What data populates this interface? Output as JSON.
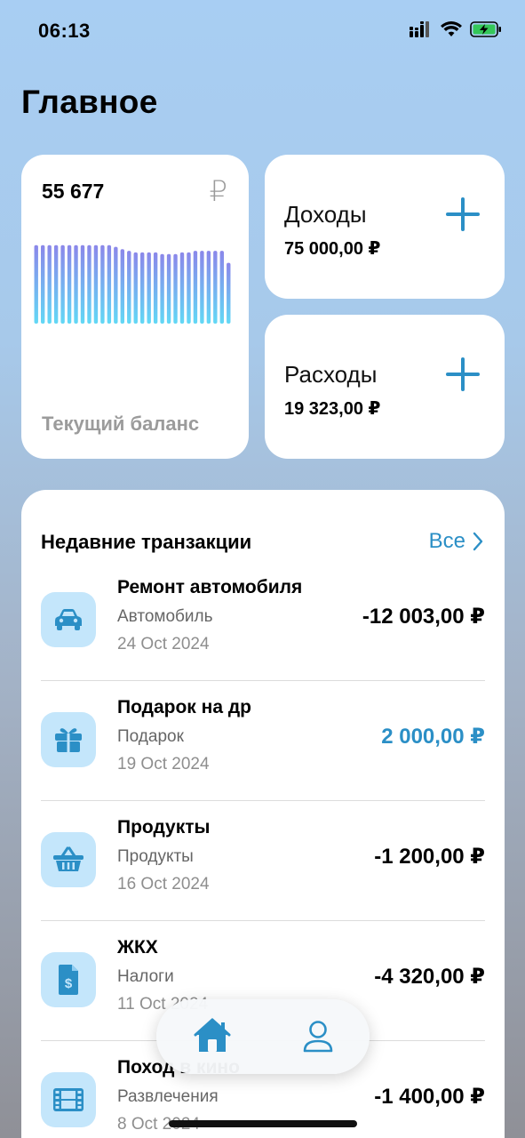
{
  "status_bar": {
    "time": "06:13",
    "signal_icon": "cellular-signal-icon",
    "wifi_icon": "wifi-icon",
    "battery_icon": "battery-charging-icon",
    "battery_color": "#34c759"
  },
  "page": {
    "title": "Главное"
  },
  "balance": {
    "amount": "55 677",
    "currency_symbol": "₽",
    "label": "Текущий баланс",
    "bar_levels": [
      0.98,
      0.98,
      0.98,
      0.98,
      0.98,
      0.98,
      0.98,
      0.98,
      0.98,
      0.98,
      0.98,
      0.98,
      0.96,
      0.93,
      0.91,
      0.89,
      0.89,
      0.89,
      0.89,
      0.87,
      0.87,
      0.87,
      0.89,
      0.89,
      0.91,
      0.91,
      0.91,
      0.91,
      0.91,
      0.76
    ],
    "bar_color_top": "#8b87ea",
    "bar_color_bottom": "#62d8f5"
  },
  "income": {
    "title": "Доходы",
    "amount": "75 000,00 ₽"
  },
  "expense": {
    "title": "Расходы",
    "amount": "19 323,00 ₽"
  },
  "accent_color": "#2b8fc6",
  "transactions": {
    "title": "Недавние транзакции",
    "all_label": "Все",
    "items": [
      {
        "name": "Ремонт автомобиля",
        "category": "Автомобиль",
        "date": "24 Oct 2024",
        "amount": "-12 003,00 ₽",
        "icon": "car-icon",
        "positive": false
      },
      {
        "name": "Подарок на др",
        "category": "Подарок",
        "date": "19 Oct 2024",
        "amount": "2 000,00 ₽",
        "icon": "gift-icon",
        "positive": true
      },
      {
        "name": "Продукты",
        "category": "Продукты",
        "date": "16 Oct 2024",
        "amount": "-1 200,00 ₽",
        "icon": "basket-icon",
        "positive": false
      },
      {
        "name": "ЖКХ",
        "category": "Налоги",
        "date": "11 Oct 2024",
        "amount": "-4 320,00 ₽",
        "icon": "invoice-icon",
        "positive": false
      },
      {
        "name": "Поход в кино",
        "category": "Развлечения",
        "date": "8 Oct 2024",
        "amount": "-1 400,00 ₽",
        "icon": "film-icon",
        "positive": false
      }
    ]
  },
  "tab_bar": {
    "home_icon": "home-icon",
    "profile_icon": "profile-icon"
  }
}
